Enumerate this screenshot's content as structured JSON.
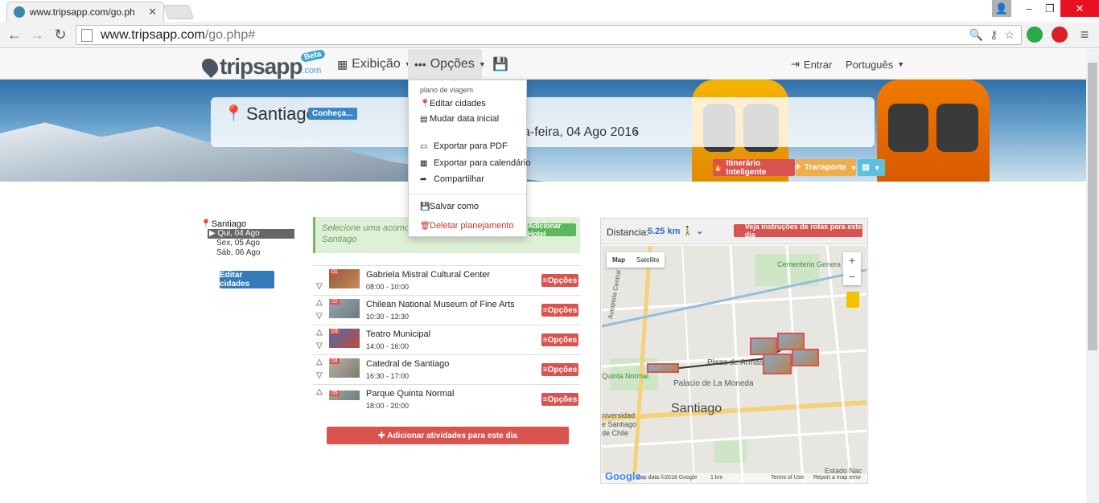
{
  "browser": {
    "tab_title": "www.tripsapp.com/go.ph",
    "url_prefix": "www.tripsapp.com",
    "url_path": "/go.php#"
  },
  "nav": {
    "logo": "tripsapp",
    "logo_com": ".com",
    "beta": "Beta",
    "exibicao": "Exibição",
    "opcoes": "Opções",
    "entrar": "Entrar",
    "idioma": "Português"
  },
  "banner": {
    "city": "Santiago",
    "conheca": "Conheça...",
    "date": "a-feira, 04 Ago 2016",
    "btn_itinerario": "Itinerário Inteligente",
    "btn_transporte": "Transporte"
  },
  "dropdown": {
    "header": "plano de viagem",
    "items": [
      "Editar cidades",
      "Mudar data inicial",
      "Exportar para PDF",
      "Exportar para calendário",
      "Compartilhar",
      "Salvar como",
      "Deletar planejamento"
    ]
  },
  "sidebar": {
    "city": "Santiago",
    "days": [
      "Qui, 04 Ago",
      "Sex, 05 Ago",
      "Sáb, 06 Ago"
    ],
    "edit_cities": "Editar cidades"
  },
  "itinerary": {
    "hotel_prompt": "Selecione uma acomodaç",
    "hotel_prompt_city": "Santiago",
    "add_hotel": "Adicionar Hotel",
    "activities": [
      {
        "num": "01",
        "name": "Gabriela Mistral Cultural Center",
        "time": "08:00 - 10:00"
      },
      {
        "num": "02",
        "name": "Chilean National Museum of Fine Arts",
        "time": "10:30 - 13:30"
      },
      {
        "num": "03",
        "name": "Teatro Municipal",
        "time": "14:00 - 16:00"
      },
      {
        "num": "04",
        "name": "Catedral de Santiago",
        "time": "16:30 - 17:00"
      },
      {
        "num": "05",
        "name": "Parque Quinta Normal",
        "time": "18:00 - 20:00"
      }
    ],
    "options_label": "Opções",
    "add_activities": "Adicionar atividades para este dia"
  },
  "map": {
    "distance_label": "Distancia:",
    "distance_value": "5.25 km",
    "route_button": "Veja instruções de rotas para este dia",
    "type_map": "Map",
    "type_satellite": "Satellite",
    "labels": {
      "cemiterio": "Cementerio Genera",
      "plaza": "Plaza de Armas",
      "palacio": "Palacio de La Moneda",
      "santiago": "Santiago",
      "quinta": "Quinta Normal",
      "estado": "Estado Nac",
      "auto": "Autopista Central",
      "universidad": "niversidad",
      "desantiago": "e Santiago",
      "dechile": "de Chile"
    },
    "footer_data": "Map data ©2016 Google",
    "footer_scale": "1 km",
    "footer_terms": "Terms of Use",
    "footer_report": "Report a map error",
    "google": "Google"
  },
  "colors": {
    "accent_red": "#d9534f",
    "accent_blue": "#337ab7",
    "accent_orange": "#f0ad4e",
    "accent_green": "#5cb85c"
  }
}
